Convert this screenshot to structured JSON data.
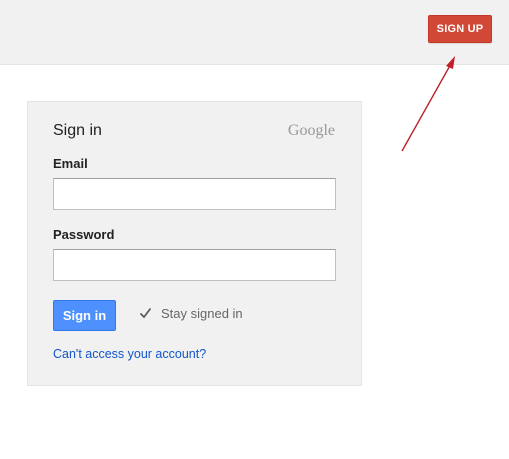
{
  "header": {
    "signup_label": "SIGN UP"
  },
  "signin_card": {
    "title": "Sign in",
    "logo_text": "Google",
    "email_label": "Email",
    "email_value": "",
    "password_label": "Password",
    "password_value": "",
    "signin_label": "Sign in",
    "stay_signed_in_label": "Stay signed in",
    "stay_signed_in_checked": true,
    "forgot_link": "Can't access your account?"
  },
  "colors": {
    "signup_red": "#d14836",
    "signin_blue": "#4d90fe",
    "link_blue": "#1155cc",
    "annotation_arrow": "#c0202a"
  },
  "icons": {
    "checkbox": "check-icon",
    "annotation": "arrow-annotation"
  }
}
